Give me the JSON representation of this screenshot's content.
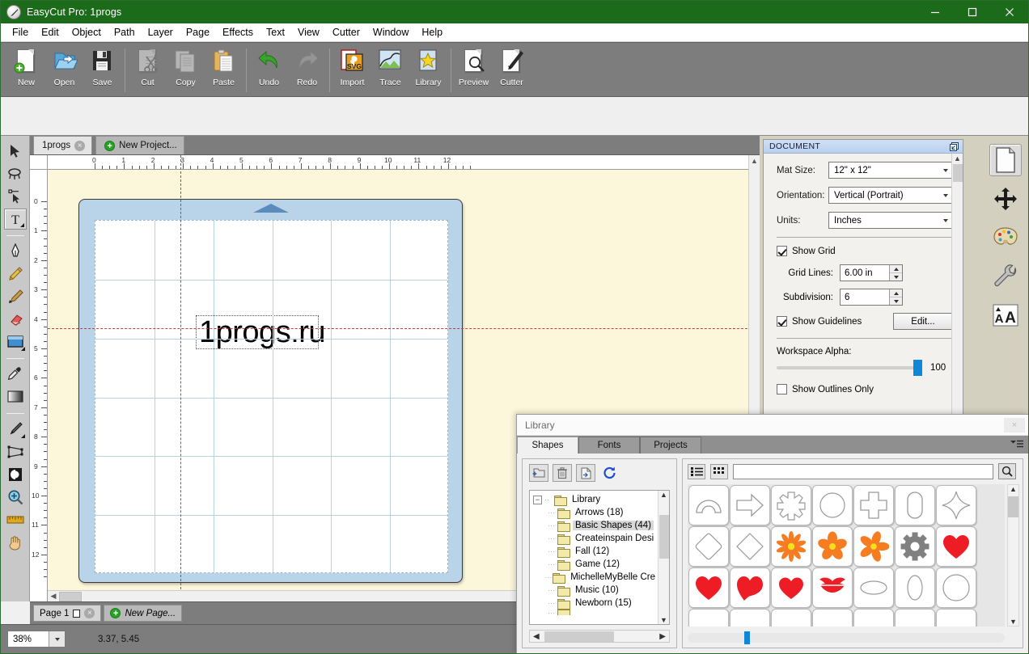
{
  "window": {
    "title": "EasyCut Pro: 1progs",
    "icon": "app-logo-icon",
    "controls": {
      "minimize": "minimize-icon",
      "maximize": "maximize-icon",
      "close": "close-icon"
    }
  },
  "menubar": {
    "items": [
      "File",
      "Edit",
      "Object",
      "Path",
      "Layer",
      "Page",
      "Effects",
      "Text",
      "View",
      "Cutter",
      "Window",
      "Help"
    ]
  },
  "toolbar": {
    "groups": [
      {
        "buttons": [
          {
            "label": "New",
            "icon": "new-document-icon",
            "disabled": false
          },
          {
            "label": "Open",
            "icon": "open-folder-icon",
            "disabled": false
          },
          {
            "label": "Save",
            "icon": "floppy-disk-icon",
            "disabled": false
          }
        ]
      },
      {
        "buttons": [
          {
            "label": "Cut",
            "icon": "scissors-icon",
            "disabled": true
          },
          {
            "label": "Copy",
            "icon": "copy-pages-icon",
            "disabled": true
          },
          {
            "label": "Paste",
            "icon": "clipboard-icon",
            "disabled": false
          }
        ]
      },
      {
        "buttons": [
          {
            "label": "Undo",
            "icon": "undo-arrow-icon",
            "disabled": false
          },
          {
            "label": "Redo",
            "icon": "redo-arrow-icon",
            "disabled": true
          }
        ]
      },
      {
        "buttons": [
          {
            "label": "Import",
            "icon": "svg-import-icon",
            "disabled": false
          },
          {
            "label": "Trace",
            "icon": "trace-image-icon",
            "disabled": false
          },
          {
            "label": "Library",
            "icon": "library-star-icon",
            "disabled": false
          }
        ]
      },
      {
        "buttons": [
          {
            "label": "Preview",
            "icon": "preview-magnifier-icon",
            "disabled": false
          },
          {
            "label": "Cutter",
            "icon": "cutter-pen-icon",
            "disabled": false
          }
        ]
      }
    ]
  },
  "left_tools": [
    {
      "name": "select-arrow-tool",
      "selected": false
    },
    {
      "name": "lasso-select-tool",
      "selected": false
    },
    {
      "name": "node-edit-tool",
      "selected": false
    },
    {
      "name": "text-tool",
      "selected": true
    },
    {
      "name": "separator",
      "selected": false
    },
    {
      "name": "pen-tool",
      "selected": false
    },
    {
      "name": "pencil-tool",
      "selected": false
    },
    {
      "name": "brush-tool",
      "selected": false
    },
    {
      "name": "eraser-tool",
      "selected": false
    },
    {
      "name": "rectangle-shape-tool",
      "selected": false
    },
    {
      "name": "separator",
      "selected": false
    },
    {
      "name": "eyedropper-tool",
      "selected": false
    },
    {
      "name": "gradient-tool",
      "selected": false
    },
    {
      "name": "separator",
      "selected": false
    },
    {
      "name": "knife-tool",
      "selected": false
    },
    {
      "name": "perspective-tool",
      "selected": false
    },
    {
      "name": "mirror-tool",
      "selected": false
    },
    {
      "name": "zoom-tool",
      "selected": false
    },
    {
      "name": "measure-ruler-tool",
      "selected": false
    },
    {
      "name": "pan-hand-tool",
      "selected": false
    }
  ],
  "document_tabs": [
    {
      "label": "1progs",
      "close": "×",
      "active": true
    },
    {
      "label": "New Project...",
      "plus": "+",
      "active": false
    }
  ],
  "canvas": {
    "h_ruler_ticks": [
      "0",
      "1",
      "2",
      "3",
      "4",
      "5",
      "6",
      "7",
      "8",
      "9",
      "10",
      "11",
      "12"
    ],
    "v_ruler_ticks": [
      "0",
      "1",
      "2",
      "3",
      "4",
      "5",
      "6",
      "7",
      "8",
      "9",
      "10",
      "11",
      "12"
    ],
    "text_object": "1progs.ru",
    "guide_h_inches": 5.45,
    "guide_v_inches": 3.37
  },
  "document_panel": {
    "title": "DOCUMENT",
    "dock_icon": "undock-panel-icon",
    "mat_size": {
      "label": "Mat Size:",
      "value": "12\" x 12\""
    },
    "orientation": {
      "label": "Orientation:",
      "value": "Vertical (Portrait)"
    },
    "units": {
      "label": "Units:",
      "value": "Inches"
    },
    "show_grid": {
      "label": "Show Grid",
      "checked": true
    },
    "grid_lines": {
      "label": "Grid Lines:",
      "value": "6.00 in"
    },
    "subdivision": {
      "label": "Subdivision:",
      "value": "6"
    },
    "show_guidelines": {
      "label": "Show Guidelines",
      "checked": true
    },
    "edit_button": "Edit...",
    "workspace_alpha": {
      "label": "Workspace Alpha:",
      "value": "100",
      "percent": 100
    },
    "show_outlines_only": {
      "label": "Show Outlines Only",
      "checked": false
    }
  },
  "right_rail": [
    {
      "name": "document-properties-icon",
      "selected": true
    },
    {
      "name": "transform-move-icon",
      "selected": false
    },
    {
      "name": "fill-color-palette-icon",
      "selected": false
    },
    {
      "name": "tools-wrench-icon",
      "selected": false
    },
    {
      "name": "text-properties-icon",
      "selected": false
    }
  ],
  "page_tabs": [
    {
      "label": "Page 1",
      "shape_icon": "page-square-icon",
      "close": "×"
    },
    {
      "label": "New Page...",
      "plus": "+"
    }
  ],
  "status": {
    "zoom": "38%",
    "coords": "3.37, 5.45"
  },
  "library_dialog": {
    "title": "Library",
    "close": "×",
    "menu_icon": "panel-menu-icon",
    "tabs": [
      {
        "label": "Shapes",
        "active": true
      },
      {
        "label": "Fonts",
        "active": false
      },
      {
        "label": "Projects",
        "active": false
      }
    ],
    "toolbuttons": [
      {
        "name": "add-folder-icon"
      },
      {
        "name": "delete-trash-icon"
      },
      {
        "name": "import-file-icon"
      },
      {
        "name": "refresh-icon"
      }
    ],
    "tree": [
      {
        "label": "Library",
        "depth": 0,
        "expander": "-",
        "selected": false
      },
      {
        "label": "Arrows (18)",
        "depth": 1,
        "selected": false
      },
      {
        "label": "Basic Shapes (44)",
        "depth": 1,
        "selected": true
      },
      {
        "label": "Createinspain Desi",
        "depth": 1,
        "selected": false
      },
      {
        "label": "Fall (12)",
        "depth": 1,
        "selected": false
      },
      {
        "label": "Game (12)",
        "depth": 1,
        "selected": false
      },
      {
        "label": "MichelleMyBelle Cre",
        "depth": 1,
        "selected": false
      },
      {
        "label": "Music (10)",
        "depth": 1,
        "selected": false
      },
      {
        "label": "Newborn (15)",
        "depth": 1,
        "selected": false
      }
    ],
    "view_list_icon": "list-view-icon",
    "view_grid_icon": "grid-view-icon",
    "search_value": "",
    "search_icon": "search-magnifier-icon",
    "shapes": [
      {
        "name": "arch-shape",
        "style": "outline"
      },
      {
        "name": "right-arrow-shape",
        "style": "outline"
      },
      {
        "name": "starburst-shape",
        "style": "outline"
      },
      {
        "name": "circle-shape",
        "style": "outline"
      },
      {
        "name": "cross-plus-shape",
        "style": "outline"
      },
      {
        "name": "rounded-rectangle-shape",
        "style": "outline"
      },
      {
        "name": "four-point-star-shape",
        "style": "outline"
      },
      {
        "name": "diamond-shape",
        "style": "outline"
      },
      {
        "name": "diamond-shape-2",
        "style": "outline"
      },
      {
        "name": "daisy-flower-shape",
        "style": "orange"
      },
      {
        "name": "five-petal-flower-shape",
        "style": "orange"
      },
      {
        "name": "five-petal-flower-shape-2",
        "style": "orange"
      },
      {
        "name": "gear-shape",
        "style": "gray"
      },
      {
        "name": "heart-shape",
        "style": "red"
      },
      {
        "name": "heart-shape-2",
        "style": "red"
      },
      {
        "name": "heart-swirl-shape",
        "style": "red"
      },
      {
        "name": "heart-shape-3",
        "style": "red"
      },
      {
        "name": "lips-shape",
        "style": "red"
      },
      {
        "name": "ellipse-wide-shape",
        "style": "outline"
      },
      {
        "name": "ellipse-tall-shape",
        "style": "outline"
      },
      {
        "name": "polygon-round-shape",
        "style": "outline"
      }
    ]
  },
  "colors": {
    "titlebar": "#1b6b1b",
    "accent_blue": "#0f86d8",
    "panel_header": "#c2d8f2",
    "mat": "#b9d3e8",
    "workspace": "#fcf6db",
    "red": "#ee1c25",
    "orange": "#f57c20",
    "gray_shape": "#808080"
  }
}
